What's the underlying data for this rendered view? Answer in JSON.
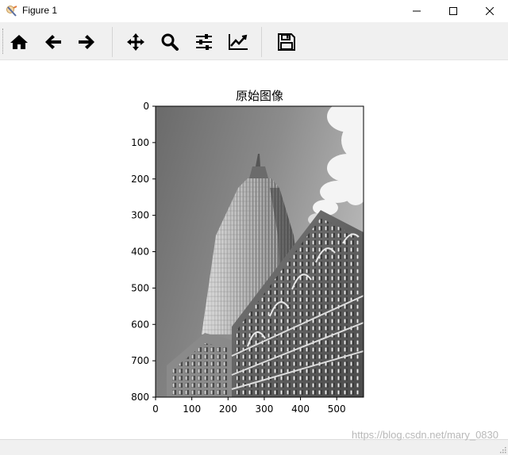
{
  "window": {
    "title": "Figure 1"
  },
  "toolbar": {
    "items": [
      {
        "name": "home",
        "icon": "home-icon"
      },
      {
        "name": "back",
        "icon": "arrow-left-icon"
      },
      {
        "name": "forward",
        "icon": "arrow-right-icon"
      },
      {
        "name": "pan",
        "icon": "move-icon"
      },
      {
        "name": "zoom",
        "icon": "magnifier-icon"
      },
      {
        "name": "subplots",
        "icon": "sliders-icon"
      },
      {
        "name": "edit-axis",
        "icon": "chart-line-icon"
      },
      {
        "name": "save",
        "icon": "floppy-disk-icon"
      }
    ]
  },
  "figure": {
    "title": "原始图像",
    "image_description": "grayscale photo of a skyscraper and building facade",
    "x_ticks": [
      "0",
      "100",
      "200",
      "300",
      "400",
      "500"
    ],
    "y_ticks": [
      "0",
      "100",
      "200",
      "300",
      "400",
      "500",
      "600",
      "700",
      "800"
    ],
    "x_tick_values": [
      0,
      100,
      200,
      300,
      400,
      500
    ],
    "y_tick_values": [
      0,
      100,
      200,
      300,
      400,
      500,
      600,
      700,
      800
    ],
    "x_range": [
      0,
      574
    ],
    "y_range": [
      0,
      800
    ]
  },
  "status": {
    "watermark": "https://blog.csdn.net/mary_0830"
  },
  "colors": {
    "toolbar_bg": "#f0f0f0",
    "icon": "#000000"
  }
}
